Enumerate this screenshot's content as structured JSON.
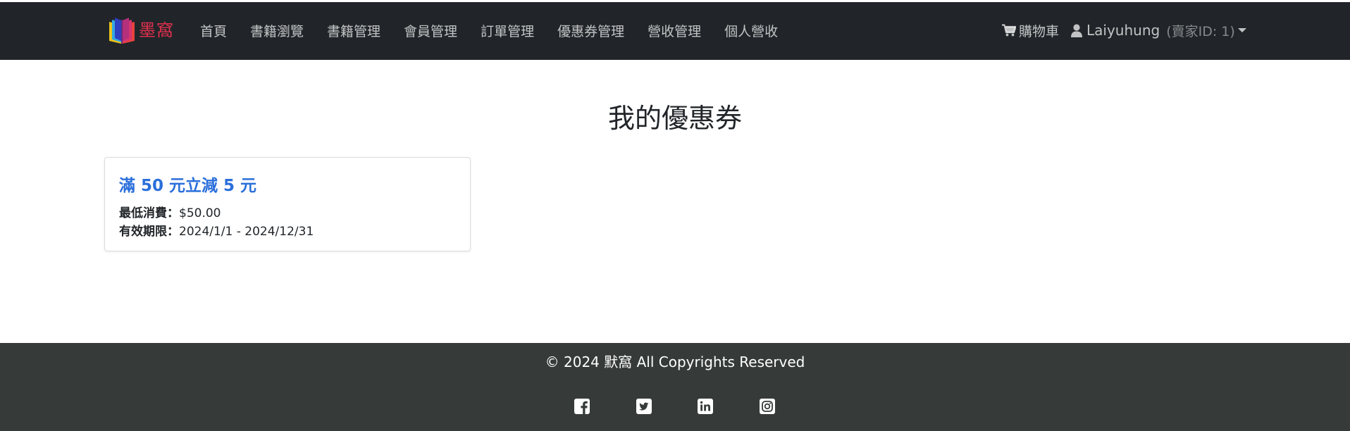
{
  "navbar": {
    "brand": "墨窩",
    "items": [
      {
        "label": "首頁"
      },
      {
        "label": "書籍瀏覽"
      },
      {
        "label": "書籍管理"
      },
      {
        "label": "會員管理"
      },
      {
        "label": "訂單管理"
      },
      {
        "label": "優惠券管理"
      },
      {
        "label": "營收管理"
      },
      {
        "label": "個人營收"
      }
    ],
    "cart_label": "購物車",
    "username": "Laiyuhung",
    "seller_id": "(賣家ID: 1)"
  },
  "main": {
    "title": "我的優惠券",
    "coupons": [
      {
        "title": "滿 50 元立減 5 元",
        "min_spend_label": "最低消費：",
        "min_spend_value": "$50.00",
        "validity_label": "有效期限：",
        "validity_value": "2024/1/1 - 2024/12/31"
      }
    ]
  },
  "footer": {
    "copyright": "© 2024 默窩 All Copyrights Reserved",
    "social": [
      {
        "icon": "facebook-icon"
      },
      {
        "icon": "twitter-icon"
      },
      {
        "icon": "linkedin-icon"
      },
      {
        "icon": "instagram-icon"
      }
    ]
  },
  "colors": {
    "navbar_bg": "#212529",
    "brand_text": "#e0304e",
    "coupon_title": "#2a6fdb",
    "footer_bg": "#363b3a"
  }
}
